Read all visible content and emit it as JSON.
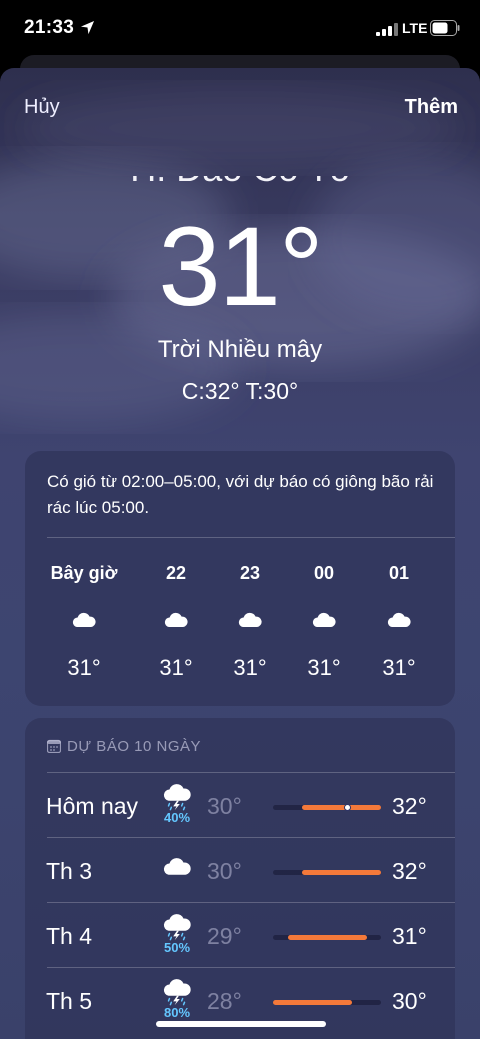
{
  "status_bar": {
    "time": "21:33",
    "network": "LTE"
  },
  "nav": {
    "cancel_label": "Hủy",
    "add_label": "Thêm"
  },
  "current": {
    "location": "H. Đảo Cô Tô",
    "temperature": "31°",
    "condition": "Trời Nhiều mây",
    "high_low": "C:32°  T:30°"
  },
  "hourly": {
    "summary": "Có gió từ 02:00–05:00, với dự báo có giông bão rải rác lúc 05:00.",
    "items": [
      {
        "label": "Bây giờ",
        "icon": "cloud-icon",
        "temp": "31°"
      },
      {
        "label": "22",
        "icon": "cloud-icon",
        "temp": "31°"
      },
      {
        "label": "23",
        "icon": "cloud-icon",
        "temp": "31°"
      },
      {
        "label": "00",
        "icon": "cloud-icon",
        "temp": "31°"
      },
      {
        "label": "01",
        "icon": "cloud-icon",
        "temp": "31°"
      }
    ]
  },
  "daily": {
    "header": "DỰ BÁO 10 NGÀY",
    "range_min": 28,
    "range_max": 32,
    "days": [
      {
        "name": "Hôm nay",
        "icon": "thunderstorm-icon",
        "precip": "40%",
        "low": "30°",
        "high": "32°",
        "low_value": 30,
        "high_value": 32,
        "current_value": 31
      },
      {
        "name": "Th 3",
        "icon": "cloud-icon",
        "precip": "",
        "low": "30°",
        "high": "32°",
        "low_value": 30,
        "high_value": 32
      },
      {
        "name": "Th 4",
        "icon": "thunderstorm-icon",
        "precip": "50%",
        "low": "29°",
        "high": "31°",
        "low_value": 29,
        "high_value": 31
      },
      {
        "name": "Th 5",
        "icon": "thunderstorm-icon",
        "precip": "80%",
        "low": "28°",
        "high": "30°",
        "low_value": 28,
        "high_value": 30
      }
    ]
  },
  "colors": {
    "accent_bar": "#f4793a",
    "precip": "#64c7ff"
  }
}
